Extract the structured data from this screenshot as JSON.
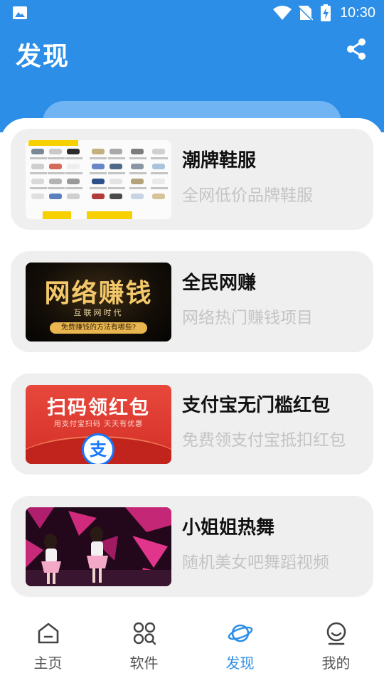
{
  "status_bar": {
    "time": "10:30",
    "icons": [
      "gallery-icon",
      "wifi-icon",
      "no-sim-icon",
      "battery-charging-icon"
    ]
  },
  "header": {
    "title": "发现",
    "share_icon": "share-icon"
  },
  "colors": {
    "primary": "#2c8ee6",
    "card_bg": "#efefef",
    "subtitle": "#c4c4c4"
  },
  "cards": [
    {
      "title": "潮牌鞋服",
      "subtitle": "全网低价品牌鞋服",
      "thumb": {
        "image": "sneaker-grid"
      }
    },
    {
      "title": "全民网赚",
      "subtitle": "网络热门赚钱项目",
      "thumb": {
        "image": "earn-money-banner",
        "headline": "网络赚钱",
        "tagline": "互联网时代",
        "caption": "免费赚钱的方法有哪些?"
      }
    },
    {
      "title": "支付宝无门槛红包",
      "subtitle": "免费领支付宝抵扣红包",
      "thumb": {
        "image": "alipay-red-packet",
        "headline": "扫码领红包",
        "tagline": "用支付宝扫码  天天有优惠",
        "logo_char": "支"
      }
    },
    {
      "title": "小姐姐热舞",
      "subtitle": "随机美女吧舞蹈视频",
      "thumb": {
        "image": "dance-stage-photo"
      }
    }
  ],
  "tabs": [
    {
      "label": "主页",
      "icon": "home-icon",
      "active": false
    },
    {
      "label": "软件",
      "icon": "apps-icon",
      "active": false
    },
    {
      "label": "发现",
      "icon": "planet-icon",
      "active": true
    },
    {
      "label": "我的",
      "icon": "profile-icon",
      "active": false
    }
  ]
}
